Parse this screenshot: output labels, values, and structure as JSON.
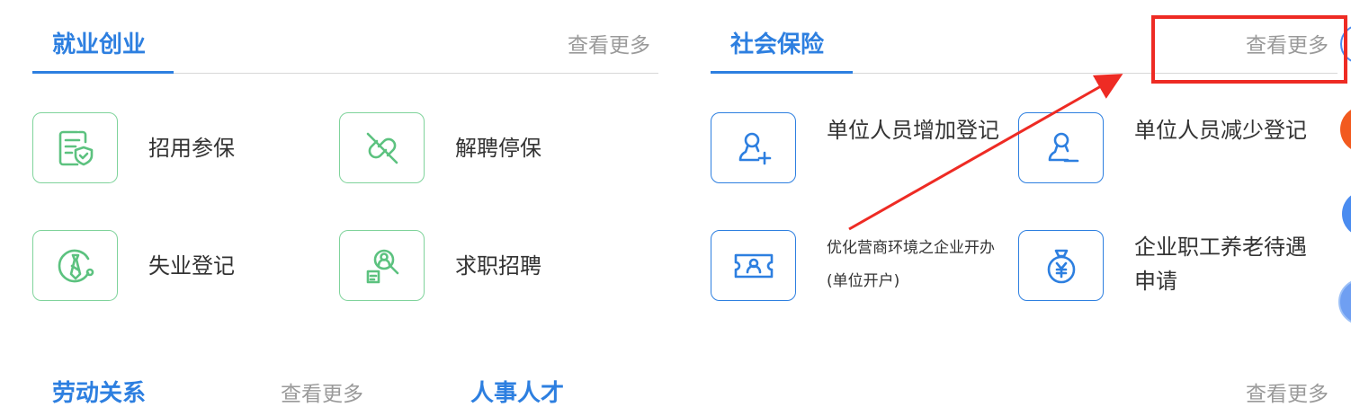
{
  "employment": {
    "title": "就业创业",
    "more": "查看更多",
    "items": [
      {
        "label": "招用参保",
        "icon": "insurance-document-icon"
      },
      {
        "label": "解聘停保",
        "icon": "broken-link-icon"
      },
      {
        "label": "失业登记",
        "icon": "tie-icon"
      },
      {
        "label": "求职招聘",
        "icon": "job-search-icon"
      }
    ]
  },
  "social_insurance": {
    "title": "社会保险",
    "more": "查看更多",
    "items": [
      {
        "label": "单位人员增加登记",
        "icon": "add-person-icon"
      },
      {
        "label": "单位人员减少登记",
        "icon": "remove-person-icon"
      },
      {
        "label_line1": "优化营商环境之企业开办",
        "label_line2": "(单位开户)",
        "icon": "account-ticket-icon"
      },
      {
        "label_line1": "企业职工养老待遇",
        "label_line2": "申请",
        "icon": "money-bag-icon"
      }
    ]
  },
  "labor": {
    "title": "劳动关系",
    "more": "查看更多"
  },
  "personnel": {
    "title": "人事人才",
    "more": "查看更多"
  },
  "colors": {
    "accent_blue": "#2d7fe0",
    "icon_green": "#5cc27f",
    "annotation_red": "#ee2b24",
    "edge_orange": "#f25a1f",
    "edge_blue": "#4a8cf0"
  }
}
